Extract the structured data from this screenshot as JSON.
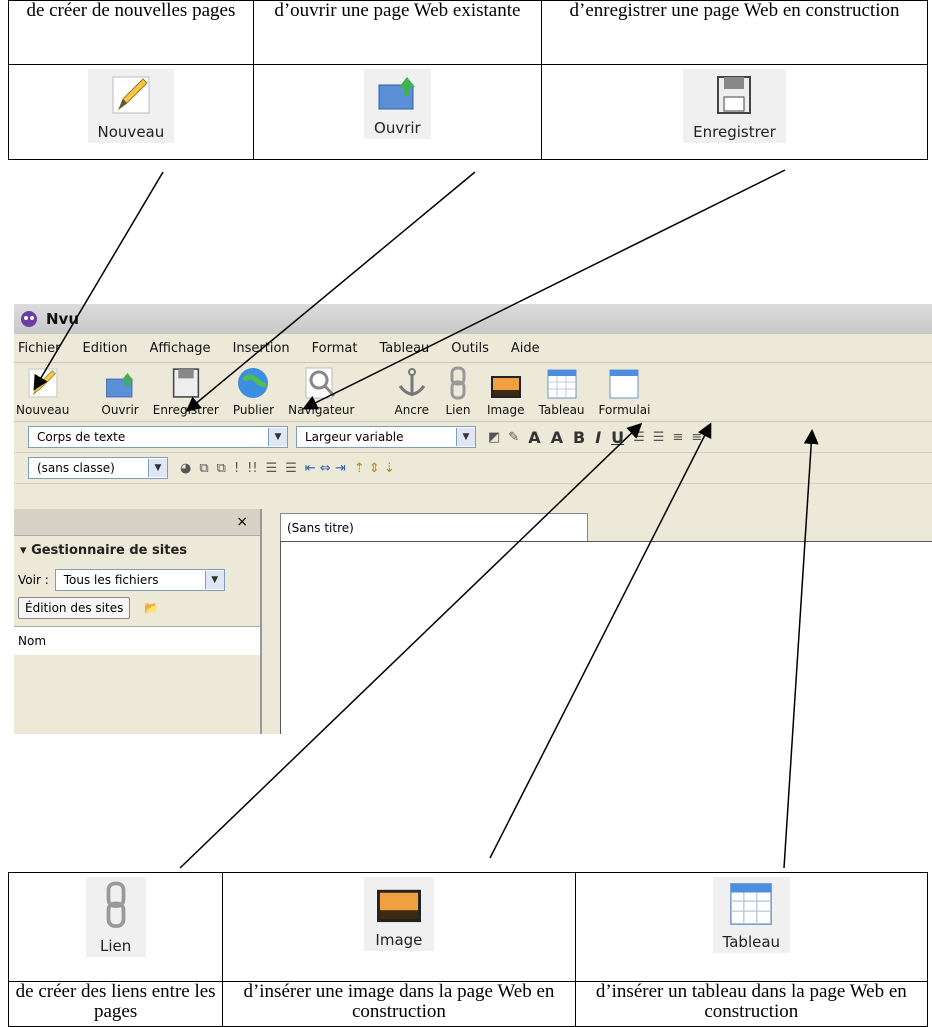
{
  "top_descriptions": [
    "de créer de nouvelles pages",
    "d’ouvrir une page Web existante",
    "d’enregistrer une page Web en construction"
  ],
  "top_icons": [
    {
      "label": "Nouveau",
      "icon": "pencil-icon"
    },
    {
      "label": "Ouvrir",
      "icon": "open-folder-icon"
    },
    {
      "label": "Enregistrer",
      "icon": "floppy-disk-icon"
    }
  ],
  "bottom_icons": [
    {
      "label": "Lien",
      "icon": "chain-link-icon"
    },
    {
      "label": "Image",
      "icon": "image-icon"
    },
    {
      "label": "Tableau",
      "icon": "table-icon"
    }
  ],
  "bottom_descriptions": [
    "de créer des liens entre les pages",
    "d’insérer une image dans la page Web en construction",
    "d’insérer un tableau dans la page Web en construction"
  ],
  "window": {
    "title": "Nvu",
    "menu": [
      "Fichier",
      "Edition",
      "Affichage",
      "Insertion",
      "Format",
      "Tableau",
      "Outils",
      "Aide"
    ],
    "toolbar": [
      "Nouveau",
      "Ouvrir",
      "Enregistrer",
      "Publier",
      "Navigateur",
      "Ancre",
      "Lien",
      "Image",
      "Tableau",
      "Formulai"
    ],
    "paragraph_style": "Corps de texte",
    "font_width": "Largeur variable",
    "class_select": "(sans classe)",
    "sidebar_close": "×",
    "site_manager": "Gestionnaire de sites",
    "view_label": "Voir :",
    "view_value": "Tous les fichiers",
    "edit_sites_button": "Édition des sites",
    "name_column": "Nom",
    "doc_tab": "(Sans titre)"
  }
}
